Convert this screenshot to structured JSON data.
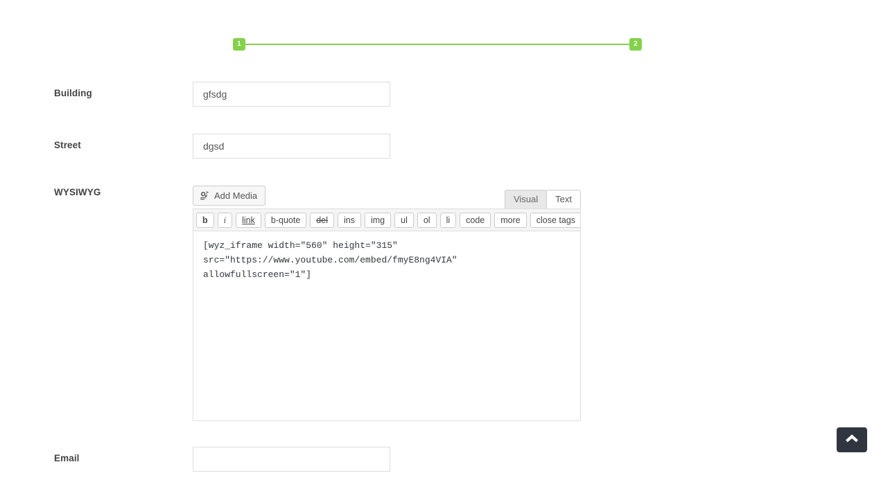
{
  "stepper": {
    "accent_color": "#84d14c",
    "steps": [
      {
        "label": "1"
      },
      {
        "label": "2"
      }
    ]
  },
  "form": {
    "building": {
      "label": "Building",
      "value": "gfsdg",
      "placeholder": ""
    },
    "street": {
      "label": "Street",
      "value": "dgsd",
      "placeholder": ""
    },
    "wysiwyg": {
      "label": "WYSIWYG",
      "add_media_label": "Add Media",
      "add_media_icon": "media-camera-music-icon",
      "tabs": [
        {
          "label": "Visual",
          "active": false
        },
        {
          "label": "Text",
          "active": true
        }
      ],
      "toolbar_buttons": [
        {
          "label": "b",
          "style": "b"
        },
        {
          "label": "i",
          "style": "i"
        },
        {
          "label": "link",
          "style": "link"
        },
        {
          "label": "b-quote",
          "style": ""
        },
        {
          "label": "del",
          "style": "del"
        },
        {
          "label": "ins",
          "style": ""
        },
        {
          "label": "img",
          "style": ""
        },
        {
          "label": "ul",
          "style": ""
        },
        {
          "label": "ol",
          "style": ""
        },
        {
          "label": "li",
          "style": ""
        },
        {
          "label": "code",
          "style": ""
        },
        {
          "label": "more",
          "style": ""
        },
        {
          "label": "close tags",
          "style": ""
        }
      ],
      "content": "[wyz_iframe width=\"560\" height=\"315\" src=\"https://www.youtube.com/embed/fmyE8ng4VIA\" allowfullscreen=\"1\"]",
      "placeholder": ""
    },
    "email": {
      "label": "Email",
      "value": "",
      "placeholder": ""
    }
  },
  "scroll_top": {
    "icon": "chevron-up-icon",
    "background_color": "#2f3640"
  }
}
